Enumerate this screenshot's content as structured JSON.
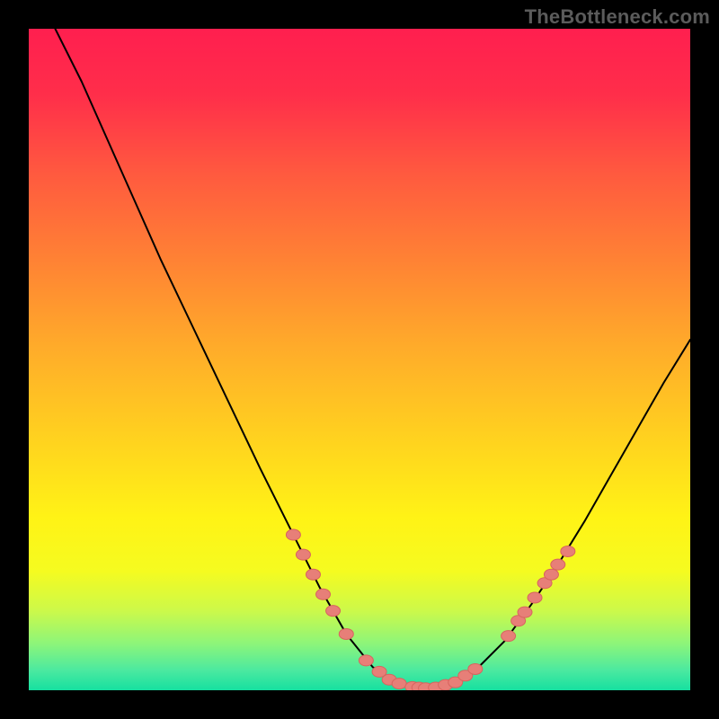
{
  "watermark": "TheBottleneck.com",
  "colors": {
    "background": "#000000",
    "gradient_stops": [
      {
        "offset": 0.0,
        "color": "#ff1f4f"
      },
      {
        "offset": 0.1,
        "color": "#ff2e4a"
      },
      {
        "offset": 0.22,
        "color": "#ff5a3f"
      },
      {
        "offset": 0.35,
        "color": "#ff8234"
      },
      {
        "offset": 0.48,
        "color": "#ffab2a"
      },
      {
        "offset": 0.62,
        "color": "#ffd21f"
      },
      {
        "offset": 0.74,
        "color": "#fff316"
      },
      {
        "offset": 0.82,
        "color": "#f5fb20"
      },
      {
        "offset": 0.88,
        "color": "#ccf94a"
      },
      {
        "offset": 0.93,
        "color": "#8cf57a"
      },
      {
        "offset": 0.97,
        "color": "#4be9a0"
      },
      {
        "offset": 1.0,
        "color": "#16e0a0"
      }
    ],
    "curve_stroke": "#000000",
    "marker_fill": "#e77f78",
    "marker_stroke": "#d8645e"
  },
  "chart_data": {
    "type": "line",
    "title": "",
    "xlabel": "",
    "ylabel": "",
    "xlim": [
      0,
      100
    ],
    "ylim": [
      0,
      100
    ],
    "grid": false,
    "curve_points": [
      {
        "x": 4.0,
        "y": 100.0
      },
      {
        "x": 8.0,
        "y": 92.0
      },
      {
        "x": 12.0,
        "y": 83.0
      },
      {
        "x": 16.0,
        "y": 74.0
      },
      {
        "x": 20.0,
        "y": 65.0
      },
      {
        "x": 25.0,
        "y": 54.5
      },
      {
        "x": 30.0,
        "y": 44.0
      },
      {
        "x": 35.0,
        "y": 33.5
      },
      {
        "x": 40.0,
        "y": 23.5
      },
      {
        "x": 44.0,
        "y": 15.5
      },
      {
        "x": 48.0,
        "y": 8.5
      },
      {
        "x": 52.0,
        "y": 3.5
      },
      {
        "x": 56.0,
        "y": 1.0
      },
      {
        "x": 60.0,
        "y": 0.3
      },
      {
        "x": 64.0,
        "y": 1.0
      },
      {
        "x": 68.0,
        "y": 3.5
      },
      {
        "x": 72.0,
        "y": 7.5
      },
      {
        "x": 76.0,
        "y": 13.0
      },
      {
        "x": 80.0,
        "y": 19.0
      },
      {
        "x": 84.0,
        "y": 25.5
      },
      {
        "x": 88.0,
        "y": 32.5
      },
      {
        "x": 92.0,
        "y": 39.5
      },
      {
        "x": 96.0,
        "y": 46.5
      },
      {
        "x": 100.0,
        "y": 53.0
      }
    ],
    "markers": [
      {
        "x": 40.0,
        "y": 23.5
      },
      {
        "x": 41.5,
        "y": 20.5
      },
      {
        "x": 43.0,
        "y": 17.5
      },
      {
        "x": 44.5,
        "y": 14.5
      },
      {
        "x": 46.0,
        "y": 12.0
      },
      {
        "x": 48.0,
        "y": 8.5
      },
      {
        "x": 51.0,
        "y": 4.5
      },
      {
        "x": 53.0,
        "y": 2.8
      },
      {
        "x": 54.5,
        "y": 1.6
      },
      {
        "x": 56.0,
        "y": 1.0
      },
      {
        "x": 58.0,
        "y": 0.5
      },
      {
        "x": 59.0,
        "y": 0.4
      },
      {
        "x": 60.0,
        "y": 0.3
      },
      {
        "x": 61.5,
        "y": 0.4
      },
      {
        "x": 63.0,
        "y": 0.8
      },
      {
        "x": 64.5,
        "y": 1.2
      },
      {
        "x": 66.0,
        "y": 2.2
      },
      {
        "x": 67.5,
        "y": 3.2
      },
      {
        "x": 72.5,
        "y": 8.2
      },
      {
        "x": 74.0,
        "y": 10.5
      },
      {
        "x": 75.0,
        "y": 11.8
      },
      {
        "x": 76.5,
        "y": 14.0
      },
      {
        "x": 78.0,
        "y": 16.2
      },
      {
        "x": 79.0,
        "y": 17.5
      },
      {
        "x": 80.0,
        "y": 19.0
      },
      {
        "x": 81.5,
        "y": 21.0
      }
    ]
  }
}
